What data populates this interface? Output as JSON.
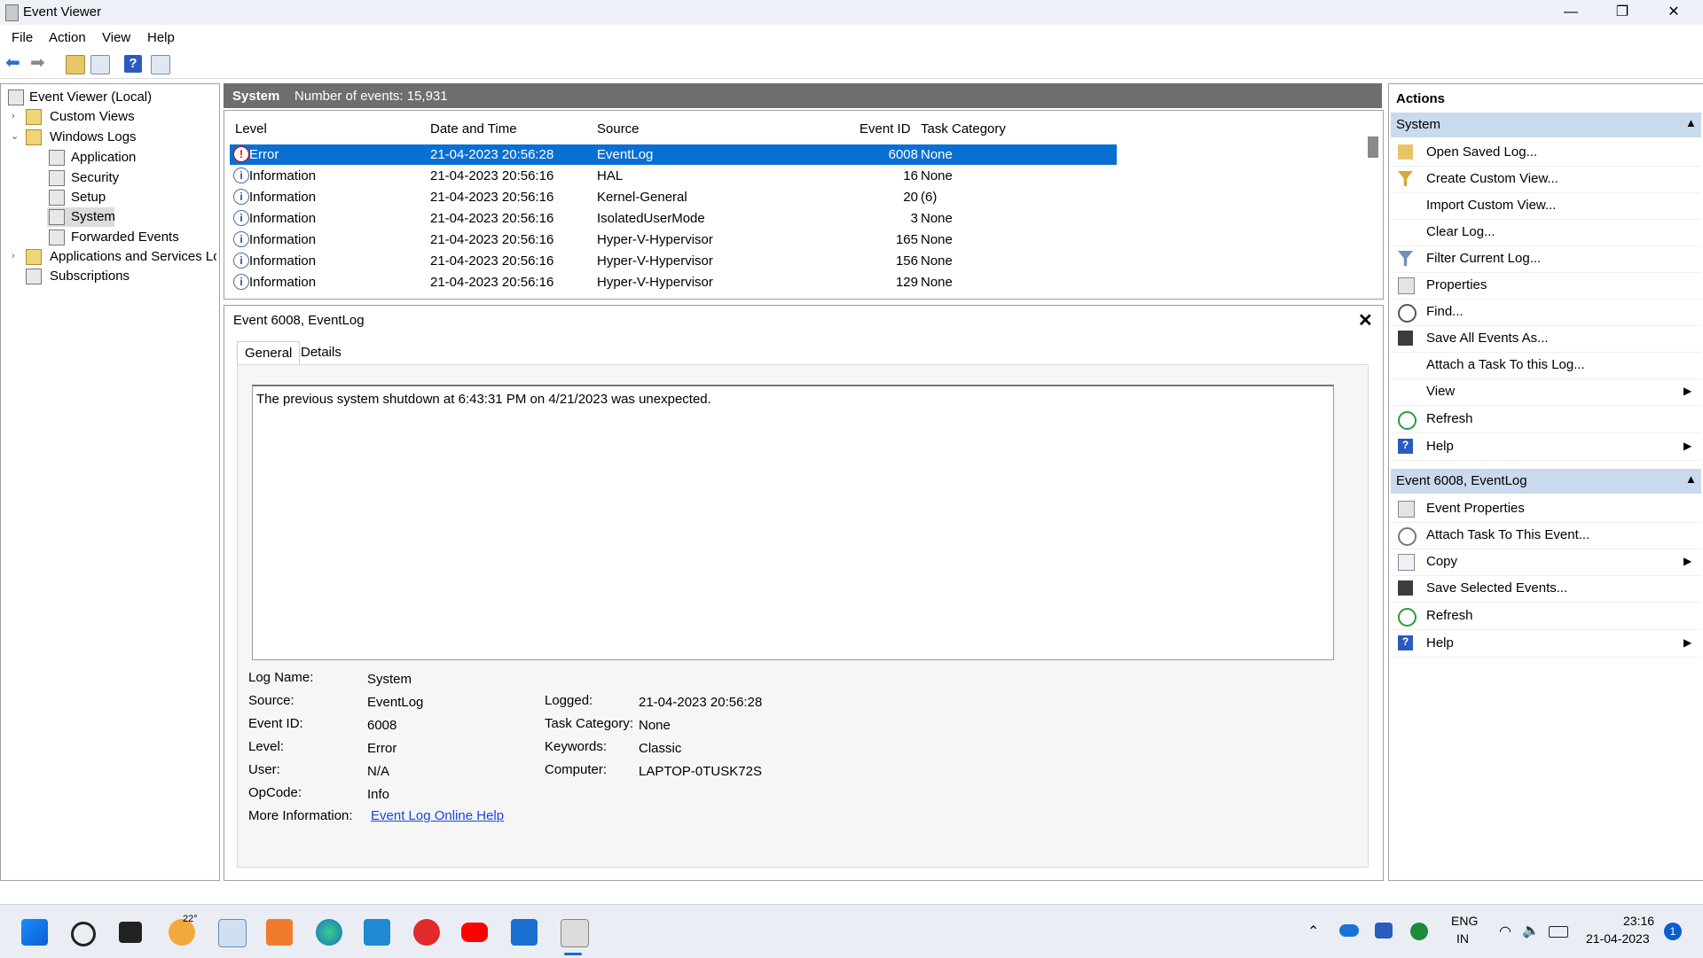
{
  "window": {
    "title": "Event Viewer",
    "minimize": "—",
    "restore": "❐",
    "close": "✕"
  },
  "menu": [
    "File",
    "Action",
    "View",
    "Help"
  ],
  "tree": {
    "root": "Event Viewer (Local)",
    "custom_views": "Custom Views",
    "windows_logs": "Windows Logs",
    "logs": [
      "Application",
      "Security",
      "Setup",
      "System",
      "Forwarded Events"
    ],
    "apps_services": "Applications and Services Log",
    "subscriptions": "Subscriptions"
  },
  "center": {
    "log_name": "System",
    "count_text": "Number of events: 15,931",
    "columns": [
      "Level",
      "Date and Time",
      "Source",
      "Event ID",
      "Task Category"
    ],
    "rows": [
      {
        "level": "Error",
        "datetime": "21-04-2023 20:56:28",
        "source": "EventLog",
        "event_id": "6008",
        "task": "None"
      },
      {
        "level": "Information",
        "datetime": "21-04-2023 20:56:16",
        "source": "HAL",
        "event_id": "16",
        "task": "None"
      },
      {
        "level": "Information",
        "datetime": "21-04-2023 20:56:16",
        "source": "Kernel-General",
        "event_id": "20",
        "task": "(6)"
      },
      {
        "level": "Information",
        "datetime": "21-04-2023 20:56:16",
        "source": "IsolatedUserMode",
        "event_id": "3",
        "task": "None"
      },
      {
        "level": "Information",
        "datetime": "21-04-2023 20:56:16",
        "source": "Hyper-V-Hypervisor",
        "event_id": "165",
        "task": "None"
      },
      {
        "level": "Information",
        "datetime": "21-04-2023 20:56:16",
        "source": "Hyper-V-Hypervisor",
        "event_id": "156",
        "task": "None"
      },
      {
        "level": "Information",
        "datetime": "21-04-2023 20:56:16",
        "source": "Hyper-V-Hypervisor",
        "event_id": "129",
        "task": "None"
      }
    ]
  },
  "detail": {
    "title": "Event 6008, EventLog",
    "close": "✕",
    "tabs": [
      "General",
      "Details"
    ],
    "description": "The previous system shutdown at 6:43:31 PM on 4/21/2023 was unexpected.",
    "fields": {
      "log_name_label": "Log Name:",
      "log_name": "System",
      "source_label": "Source:",
      "source": "EventLog",
      "event_id_label": "Event ID:",
      "event_id": "6008",
      "level_label": "Level:",
      "level": "Error",
      "user_label": "User:",
      "user": "N/A",
      "opcode_label": "OpCode:",
      "opcode": "Info",
      "more_info_label": "More Information:",
      "more_info_link": "Event Log Online Help",
      "logged_label": "Logged:",
      "logged": "21-04-2023 20:56:28",
      "task_category_label": "Task Category:",
      "task_category": "None",
      "keywords_label": "Keywords:",
      "keywords": "Classic",
      "computer_label": "Computer:",
      "computer": "LAPTOP-0TUSK72S"
    }
  },
  "actions": {
    "title": "Actions",
    "section1": "System",
    "items1": [
      "Open Saved Log...",
      "Create Custom View...",
      "Import Custom View...",
      "Clear Log...",
      "Filter Current Log...",
      "Properties",
      "Find...",
      "Save All Events As...",
      "Attach a Task To this Log...",
      "View",
      "Refresh",
      "Help"
    ],
    "section2": "Event 6008, EventLog",
    "items2": [
      "Event Properties",
      "Attach Task To This Event...",
      "Copy",
      "Save Selected Events...",
      "Refresh",
      "Help"
    ]
  },
  "taskbar": {
    "weather": "22°",
    "lang": "ENG",
    "region": "IN",
    "time": "23:16",
    "date": "21-04-2023",
    "notifications": "1"
  }
}
